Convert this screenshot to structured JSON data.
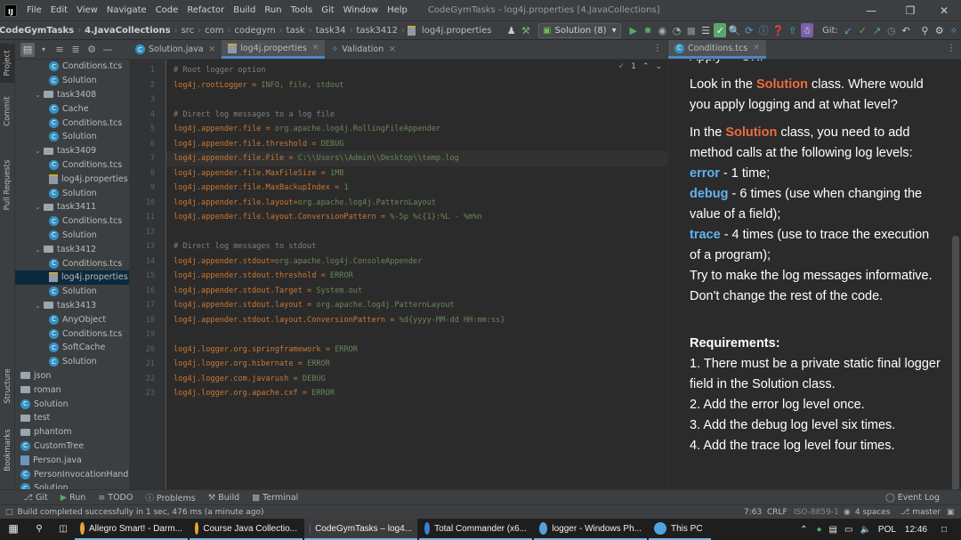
{
  "menubar": {
    "items": [
      "File",
      "Edit",
      "View",
      "Navigate",
      "Code",
      "Refactor",
      "Build",
      "Run",
      "Tools",
      "Git",
      "Window",
      "Help"
    ],
    "title": "CodeGymTasks - log4j.properties [4.JavaCollections]"
  },
  "navbar": {
    "project": "CodeGymTasks",
    "module": "4.JavaCollections",
    "path": [
      "src",
      "com",
      "codegym",
      "task",
      "task34",
      "task3412"
    ],
    "file": "log4j.properties",
    "run_config": "Solution (8)",
    "git_label": "Git:"
  },
  "left_strip": [
    "Project",
    "Commit",
    "Pull Requests",
    "Structure",
    "Bookmarks"
  ],
  "tree": [
    {
      "label": "Conditions.tcs",
      "type": "c",
      "indent": 2
    },
    {
      "label": "Solution",
      "type": "c",
      "indent": 2
    },
    {
      "label": "task3408",
      "type": "folder",
      "indent": 1
    },
    {
      "label": "Cache",
      "type": "c",
      "indent": 2
    },
    {
      "label": "Conditions.tcs",
      "type": "c",
      "indent": 2
    },
    {
      "label": "Solution",
      "type": "c",
      "indent": 2
    },
    {
      "label": "task3409",
      "type": "folder",
      "indent": 1
    },
    {
      "label": "Conditions.tcs",
      "type": "c",
      "indent": 2
    },
    {
      "label": "log4j.properties",
      "type": "p",
      "indent": 2
    },
    {
      "label": "Solution",
      "type": "c",
      "indent": 2
    },
    {
      "label": "task3411",
      "type": "folder",
      "indent": 1
    },
    {
      "label": "Conditions.tcs",
      "type": "c",
      "indent": 2
    },
    {
      "label": "Solution",
      "type": "c",
      "indent": 2
    },
    {
      "label": "task3412",
      "type": "folder",
      "indent": 1
    },
    {
      "label": "Conditions.tcs",
      "type": "c",
      "indent": 2
    },
    {
      "label": "log4j.properties",
      "type": "p",
      "indent": 2,
      "selected": true
    },
    {
      "label": "Solution",
      "type": "c",
      "indent": 2
    },
    {
      "label": "task3413",
      "type": "folder",
      "indent": 1
    },
    {
      "label": "AnyObject",
      "type": "c",
      "indent": 2
    },
    {
      "label": "Conditions.tcs",
      "type": "c",
      "indent": 2
    },
    {
      "label": "SoftCache",
      "type": "c",
      "indent": 2
    },
    {
      "label": "Solution",
      "type": "c",
      "indent": 2
    },
    {
      "label": "json",
      "type": "folder",
      "indent": 0
    },
    {
      "label": "roman",
      "type": "folder",
      "indent": 0
    },
    {
      "label": "Solution",
      "type": "c",
      "indent": 0
    },
    {
      "label": "test",
      "type": "folder",
      "indent": 0
    },
    {
      "label": "phantom",
      "type": "folder",
      "indent": 0
    },
    {
      "label": "CustomTree",
      "type": "c",
      "indent": 0
    },
    {
      "label": "Person.java",
      "type": "j",
      "indent": 0
    },
    {
      "label": "PersonInvocationHandler",
      "type": "c",
      "indent": 0
    },
    {
      "label": "Solution",
      "type": "c",
      "indent": 0
    }
  ],
  "editor_tabs": [
    "Solution.java",
    "log4j.properties",
    "Validation"
  ],
  "inspection_count": "1",
  "code_lines": [
    {
      "n": "1",
      "t": "c",
      "text": "# Root logger option"
    },
    {
      "n": "2",
      "k": "log4j.rootLogger",
      "v": "INFO, file, stdout"
    },
    {
      "n": "3"
    },
    {
      "n": "4",
      "t": "c",
      "text": "# Direct log messages to a log file"
    },
    {
      "n": "5",
      "k": "log4j.appender.file",
      "v": "org.apache.log4j.RollingFileAppender"
    },
    {
      "n": "6",
      "k": "log4j.appender.file.threshold",
      "v": "DEBUG"
    },
    {
      "n": "7",
      "k": "log4j.appender.file.File",
      "v": "C:\\\\Users\\\\Admin\\\\Desktop\\\\temp.log",
      "cur": true
    },
    {
      "n": "8",
      "k": "log4j.appender.file.MaxFileSize",
      "v": "1MB"
    },
    {
      "n": "9",
      "k": "log4j.appender.file.MaxBackupIndex",
      "v": "1"
    },
    {
      "n": "10",
      "k": "log4j.appender.file.layout",
      "v": "org.apache.log4j.PatternLayout",
      "eq": "="
    },
    {
      "n": "11",
      "k": "log4j.appender.file.layout.ConversionPattern",
      "v": "%-5p %c{1}:%L - %m%n"
    },
    {
      "n": "12"
    },
    {
      "n": "13",
      "t": "c",
      "text": "# Direct log messages to stdout"
    },
    {
      "n": "14",
      "k": "log4j.appender.stdout",
      "v": "org.apache.log4j.ConsoleAppender",
      "eq": "="
    },
    {
      "n": "15",
      "k": "log4j.appender.stdout.threshold",
      "v": "ERROR"
    },
    {
      "n": "16",
      "k": "log4j.appender.stdout.Target",
      "v": "System.out"
    },
    {
      "n": "17",
      "k": "log4j.appender.stdout.layout",
      "v": "org.apache.log4j.PatternLayout"
    },
    {
      "n": "18",
      "k": "log4j.appender.stdout.layout.ConversionPattern",
      "v": "%d{yyyy-MM-dd HH:mm:ss}"
    },
    {
      "n": "19"
    },
    {
      "n": "20",
      "k": "log4j.logger.org.springframework",
      "v": "ERROR"
    },
    {
      "n": "21",
      "k": "log4j.logger.org.hibernate",
      "v": "ERROR"
    },
    {
      "n": "22",
      "k": "log4j.logger.com.javarush",
      "v": "DEBUG"
    },
    {
      "n": "23",
      "k": "log4j.logger.org.apache.cxf",
      "v": "ERROR"
    }
  ],
  "task_panel": {
    "tab": "Conditions.tcs",
    "top_cut": "Apply -> OK.",
    "p1_a": "Look in the ",
    "p1_b": "Solution",
    "p1_c": " class. Where would you apply logging and at what level?",
    "p2_a": "In the ",
    "p2_b": "Solution",
    "p2_c": " class, you need to add method calls at the following log levels:",
    "l1_a": "error",
    "l1_b": " - 1 time;",
    "l2_a": "debug",
    "l2_b": " - 6 times (use when changing the value of a field);",
    "l3_a": "trace",
    "l3_b": " - 4 times (use to trace the execution of a program);",
    "l4": "Try to make the log messages informative.",
    "l5": "Don't change the rest of the code.",
    "req_title": "Requirements:",
    "reqs": [
      "1. There must be a private static final logger field in the Solution class.",
      "2. Add the error log level once.",
      "3. Add the debug log level six times.",
      "4. Add the trace log level four times."
    ]
  },
  "bottom_tools": [
    "Git",
    "Run",
    "TODO",
    "Problems",
    "Build",
    "Terminal"
  ],
  "event_log": "Event Log",
  "status": {
    "message": "Build completed successfully in 1 sec, 476 ms (a minute ago)",
    "position": "7:63",
    "line_sep": "CRLF",
    "encoding": "ISO-8859-1",
    "indent": "4 spaces",
    "branch": "master"
  },
  "taskbar": {
    "apps": [
      {
        "label": "Allegro Smart! - Darm...",
        "color": "#e8a33d"
      },
      {
        "label": "Course Java Collectio...",
        "color": "#e8a33d"
      },
      {
        "label": "CodeGymTasks – log4...",
        "color": "#6b4fbb"
      },
      {
        "label": "Total Commander (x6...",
        "color": "#3d7fd6"
      },
      {
        "label": "logger - Windows Ph...",
        "color": "#5aa0d8"
      },
      {
        "label": "This PC",
        "color": "#4fa3e0"
      }
    ],
    "lang": "POL",
    "time": "12:46"
  }
}
